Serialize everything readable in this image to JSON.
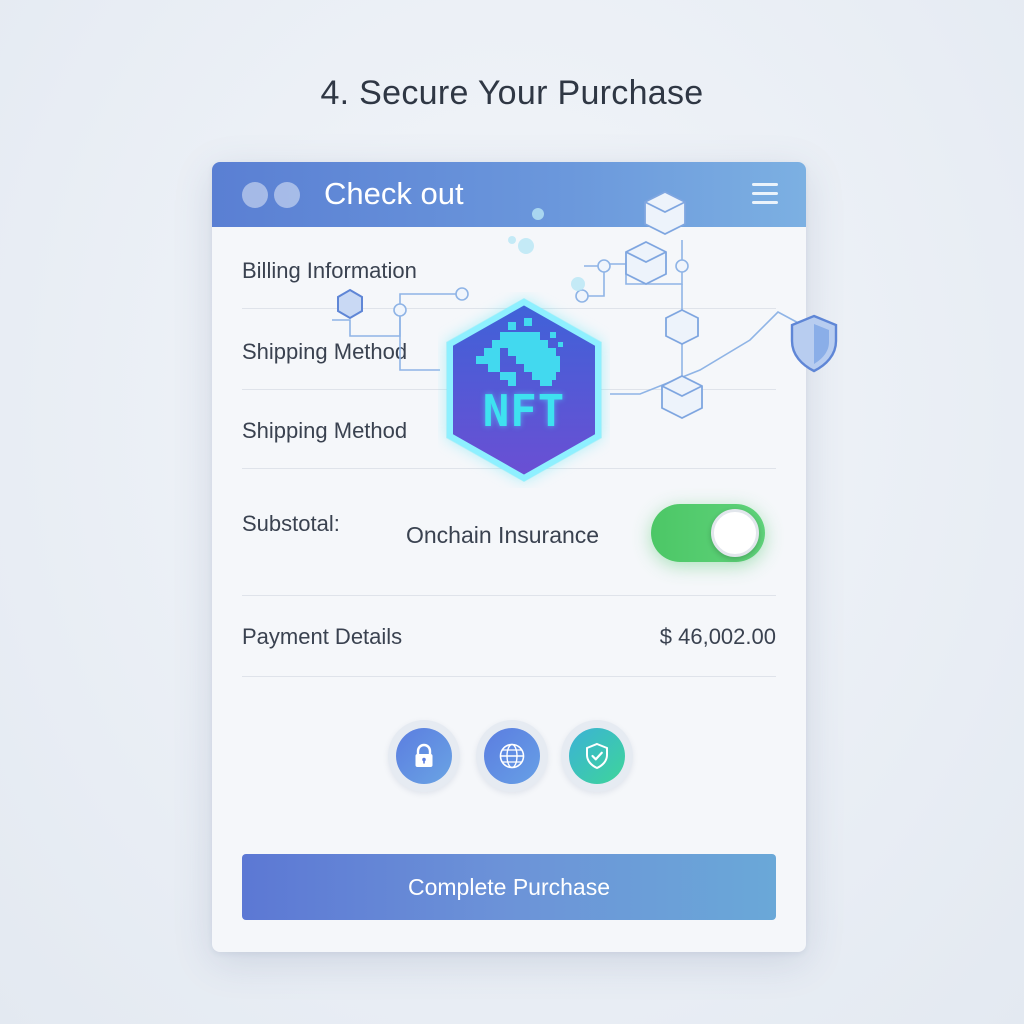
{
  "page": {
    "title": "4. Secure Your Purchase"
  },
  "window": {
    "title": "Check out",
    "icons": {
      "menu": "hamburger-menu-icon"
    }
  },
  "rows": {
    "billing": "Billing Information",
    "shipping_1": "Shipping Method",
    "shipping_2": "Shipping Method",
    "subtotal": "Substotal:",
    "payment": "Payment Details"
  },
  "insurance": {
    "label": "Onchain Insurance",
    "enabled": true
  },
  "price": "$ 46,002.00",
  "nft_badge": {
    "text": "NFT"
  },
  "security_badges": [
    "lock-icon",
    "globe-icon",
    "shield-check-icon"
  ],
  "cta": {
    "label": "Complete Purchase"
  },
  "colors": {
    "accent": "#5a7fd3",
    "toggle_on": "#4cc766",
    "nft_glow": "#3ee2f0"
  }
}
